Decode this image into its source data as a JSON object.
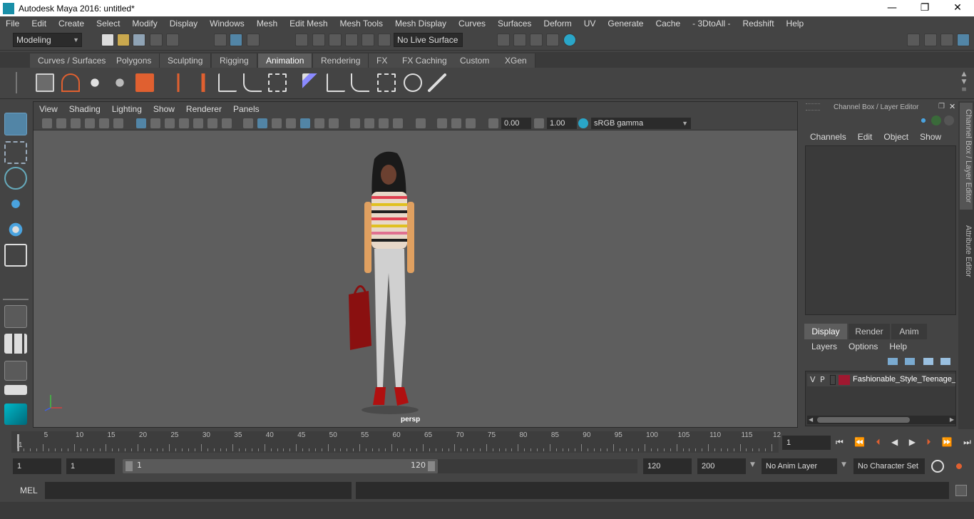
{
  "window": {
    "title": "Autodesk Maya 2016: untitled*",
    "minimize": "—",
    "maximize": "❐",
    "close": "✕"
  },
  "menubar": [
    "File",
    "Edit",
    "Create",
    "Select",
    "Modify",
    "Display",
    "Windows",
    "Mesh",
    "Edit Mesh",
    "Mesh Tools",
    "Mesh Display",
    "Curves",
    "Surfaces",
    "Deform",
    "UV",
    "Generate",
    "Cache",
    "- 3DtoAll -",
    "Redshift",
    "Help"
  ],
  "statusline": {
    "mode": "Modeling",
    "live_surface": "No Live Surface"
  },
  "shelf": {
    "tabs": [
      "Curves / Surfaces",
      "Polygons",
      "Sculpting",
      "Rigging",
      "Animation",
      "Rendering",
      "FX",
      "FX Caching",
      "Custom",
      "XGen"
    ],
    "active_tab": "Animation"
  },
  "viewport": {
    "menu": [
      "View",
      "Shading",
      "Lighting",
      "Show",
      "Renderer",
      "Panels"
    ],
    "exposure": "0.00",
    "gamma": "1.00",
    "color_space": "sRGB gamma",
    "camera": "persp"
  },
  "channel_box": {
    "title": "Channel Box / Layer Editor",
    "menu": [
      "Channels",
      "Edit",
      "Object",
      "Show"
    ]
  },
  "layer_editor": {
    "tabs": [
      "Display",
      "Render",
      "Anim"
    ],
    "active_tab": "Display",
    "menu": [
      "Layers",
      "Options",
      "Help"
    ],
    "layer": {
      "v": "V",
      "p": "P",
      "name": "Fashionable_Style_Teenage_I",
      "color": "#a01830"
    }
  },
  "side_tabs": [
    "Channel Box / Layer Editor",
    "Attribute Editor"
  ],
  "timeline": {
    "ticks": [
      "1",
      "5",
      "10",
      "15",
      "20",
      "25",
      "30",
      "35",
      "40",
      "45",
      "50",
      "55",
      "60",
      "65",
      "70",
      "75",
      "80",
      "85",
      "90",
      "95",
      "100",
      "105",
      "110",
      "115",
      "12"
    ],
    "current_frame": "1"
  },
  "range": {
    "start": "1",
    "playback_start": "1",
    "slider_start": "1",
    "slider_end": "120",
    "playback_end": "120",
    "end": "200",
    "anim_layer": "No Anim Layer",
    "character_set": "No Character Set"
  },
  "cmdline": {
    "label": "MEL"
  },
  "colors": {
    "accent": "#5285a6",
    "bg": "#444444",
    "viewport": "#5e5e5e"
  }
}
